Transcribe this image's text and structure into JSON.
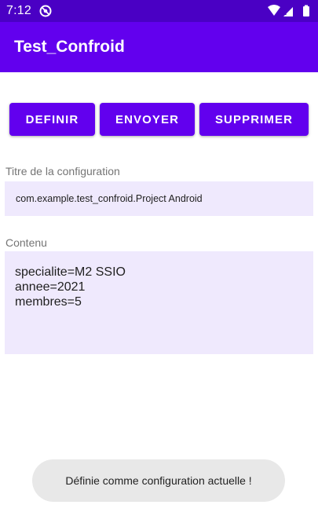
{
  "status_bar": {
    "time": "7:12",
    "notification_icon": "at-sign-icon",
    "right_icons": [
      "wifi-icon",
      "signal-icon",
      "battery-icon"
    ],
    "background": "#4a00c4"
  },
  "app_bar": {
    "title": "Test_Confroid",
    "background": "#6200ee"
  },
  "buttons": {
    "definir": "DEFINIR",
    "envoyer": "ENVOYER",
    "supprimer": "SUPPRIMER",
    "color": "#6200ee"
  },
  "titre": {
    "label": "Titre de la configuration",
    "value": "com.example.test_confroid.Project Android"
  },
  "contenu": {
    "label": "Contenu",
    "lines": [
      "specialite=M2 SSIO",
      "annee=2021",
      "membres=5"
    ]
  },
  "toast": {
    "message": "Définie comme configuration actuelle !"
  }
}
